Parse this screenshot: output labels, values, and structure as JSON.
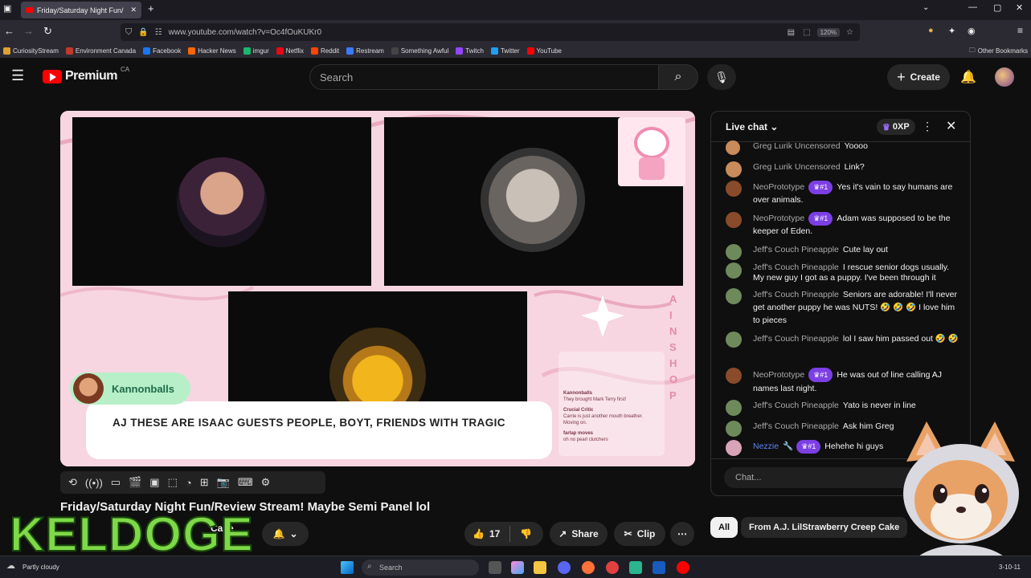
{
  "browser": {
    "tab_title": "Friday/Saturday Night Fun/",
    "url": "www.youtube.com/watch?v=Oc4fOuKUKr0",
    "zoom": "120%",
    "bookmarks": [
      {
        "label": "CuriosityStream",
        "color": "#e0a030"
      },
      {
        "label": "Environment Canada",
        "color": "#c0392b"
      },
      {
        "label": "Facebook",
        "color": "#1877f2"
      },
      {
        "label": "Hacker News",
        "color": "#ff6600"
      },
      {
        "label": "imgur",
        "color": "#1bb76e"
      },
      {
        "label": "Netflix",
        "color": "#e50914"
      },
      {
        "label": "Reddit",
        "color": "#ff4500"
      },
      {
        "label": "Restream",
        "color": "#3a7bfd"
      },
      {
        "label": "Something Awful",
        "color": "#222222"
      },
      {
        "label": "Twitch",
        "color": "#9146ff"
      },
      {
        "label": "Twitter",
        "color": "#1da1f2"
      },
      {
        "label": "YouTube",
        "color": "#ff0000"
      }
    ],
    "other_bookmarks": "Other Bookmarks"
  },
  "youtube": {
    "logo_text": "Premium",
    "region": "CA",
    "search_placeholder": "Search",
    "create_label": "Create"
  },
  "stream": {
    "guest_name": "Kannonballs",
    "caption": "AJ THESE ARE ISAAC GUESTS PEOPLE, BOYT, FRIENDS WITH TRAGIC",
    "side_text": "AIN SHOP",
    "mini_chat": [
      {
        "name": "Kannonballs",
        "text": "They brought Mark Terry first!"
      },
      {
        "name": "Crucial Critic",
        "text": "Carrie is just another mouth breather. Moving on."
      },
      {
        "name": "farlap moves",
        "text": "oh no pearl clutchers"
      }
    ]
  },
  "video": {
    "title": "Friday/Saturday Night Fun/Review Stream! Maybe Semi Panel lol",
    "channel_fragment": "Cake",
    "likes": "17",
    "share_label": "Share",
    "clip_label": "Clip"
  },
  "chat": {
    "header": "Live chat",
    "xp": "0XP",
    "input_placeholder": "Chat...",
    "messages": [
      {
        "author": "Greg Lurik Uncensored",
        "badge": "",
        "text": "Yoooo",
        "avatar": "#c98b5a"
      },
      {
        "author": "Greg Lurik Uncensored",
        "badge": "",
        "text": "Link?",
        "avatar": "#c98b5a"
      },
      {
        "author": "NeoPrototype",
        "badge": "#1",
        "text": "Yes it's vain to say humans are over animals.",
        "avatar": "#8a4b2a"
      },
      {
        "author": "NeoPrototype",
        "badge": "#1",
        "text": "Adam was supposed to be the keeper of Eden.",
        "avatar": "#8a4b2a"
      },
      {
        "author": "Jeff's Couch Pineapple",
        "badge": "",
        "text": "Cute lay out",
        "avatar": "#6f8a5a"
      },
      {
        "author": "Jeff's Couch Pineapple",
        "badge": "",
        "text": "I rescue senior dogs usually. My new guy I got as a puppy. I've been through it",
        "avatar": "#6f8a5a"
      },
      {
        "author": "Jeff's Couch Pineapple",
        "badge": "",
        "text": "Seniors are adorable! I'll never get another puppy he was NUTS! 🤣 🤣 🤣 I love him to pieces",
        "avatar": "#6f8a5a"
      },
      {
        "author": "Jeff's Couch Pineapple",
        "badge": "",
        "text": "lol I saw him passed out 🤣 🤣",
        "avatar": "#6f8a5a"
      },
      {
        "author": "NeoPrototype",
        "badge": "#1",
        "text": "He was out of line calling AJ names last night.",
        "avatar": "#8a4b2a"
      },
      {
        "author": "Jeff's Couch Pineapple",
        "badge": "",
        "text": "Yato is never in line",
        "avatar": "#6f8a5a"
      },
      {
        "author": "Jeff's Couch Pineapple",
        "badge": "",
        "text": "Ask him Greg",
        "avatar": "#6f8a5a"
      },
      {
        "author": "Nezzie",
        "badge": "#1",
        "text": "Hehehe hi guys",
        "avatar": "#d9a3b8"
      }
    ]
  },
  "filters": {
    "all": "All",
    "from": "From A.J. LilStrawberry Creep Cake"
  },
  "overlay": {
    "keldoge": "KELDOGE"
  },
  "taskbar": {
    "weather": "Partly cloudy",
    "search": "Search",
    "clock": "3-10-11"
  }
}
